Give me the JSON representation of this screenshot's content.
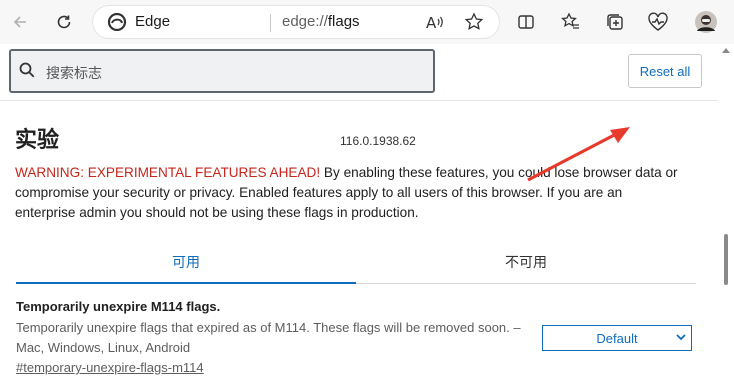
{
  "browser": {
    "site_label": "Edge",
    "url_prefix": "edge://",
    "url_path": "flags"
  },
  "icons": {
    "back": "back-arrow-icon",
    "refresh": "refresh-icon",
    "read_aloud": "read-aloud-icon",
    "favorite": "favorite-star-icon",
    "split": "split-screen-icon",
    "favorites_list": "favorites-list-icon",
    "collections": "collections-icon",
    "health": "browser-essentials-icon",
    "profile": "profile-avatar"
  },
  "search": {
    "placeholder": "搜索标志"
  },
  "reset_label": "Reset all",
  "page": {
    "title": "实验",
    "version": "116.0.1938.62",
    "warning_red": "WARNING: EXPERIMENTAL FEATURES AHEAD!",
    "warning_text": " By enabling these features, you could lose browser data or compromise your security or privacy. Enabled features apply to all users of this browser. If you are an enterprise admin you should not be using these flags in production."
  },
  "tabs": {
    "available": "可用",
    "unavailable": "不可用"
  },
  "flag": {
    "title": "Temporarily unexpire M114 flags.",
    "description": "Temporarily unexpire flags that expired as of M114. These flags will be removed soon. – Mac, Windows, Linux, Android",
    "link": "#temporary-unexpire-flags-m114",
    "selected": "Default"
  },
  "colors": {
    "accent": "#0f6cbd",
    "warning": "#c5261c",
    "annotation_arrow": "#e8392d"
  }
}
